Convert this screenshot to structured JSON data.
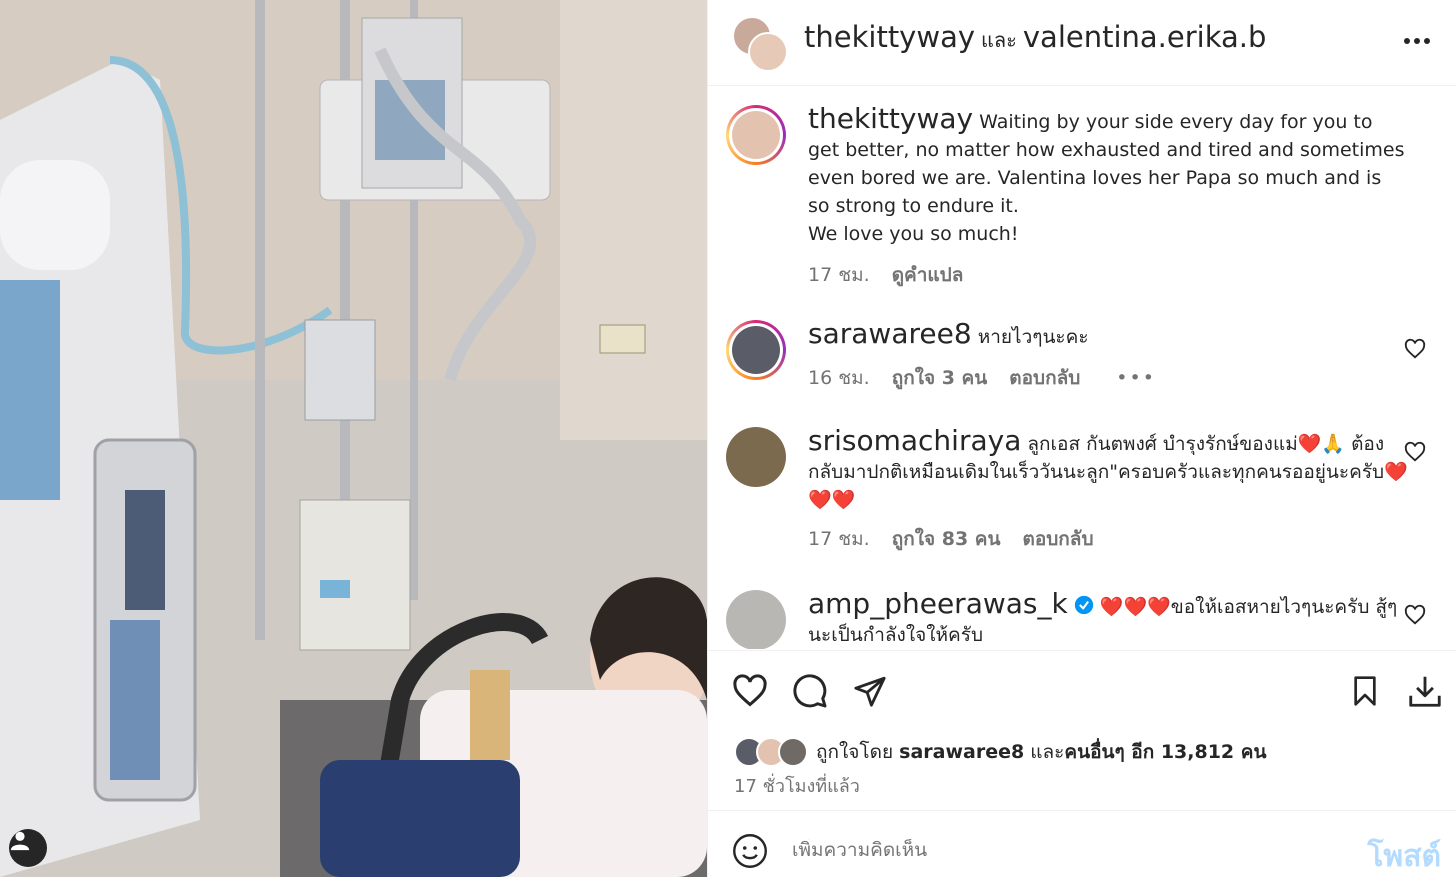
{
  "post": {
    "author": "thekittyway",
    "and_word": "และ",
    "coauthor": "valentina.erika.b",
    "more_icon": "more-horizontal-icon",
    "caption_user": "thekittyway",
    "caption_line1": "Waiting by your side every day for you to get better, no matter how exhausted and tired and sometimes even bored we are. Valentina loves her Papa so much and is so strong to endure it.",
    "caption_line2": "We love you so much!",
    "caption_time": "17 ชม.",
    "caption_translate": "ดูคำแปล"
  },
  "comments": [
    {
      "user": "sarawaree8",
      "text": "หายไวๆนะคะ",
      "time": "16 ชม.",
      "likes": "ถูกใจ 3 คน",
      "reply": "ตอบกลับ",
      "more": "•••"
    },
    {
      "user": "srisomachiraya",
      "text": "ลูกเอส กันตพงศ์ บำรุงรักษ์ของแม่❤️🙏 ต้องกลับมาปกติเหมือนเดิมในเร็ววันนะลูก\"ครอบครัวและทุกคนรออยู่นะครับ❤️❤️❤️",
      "time": "17 ชม.",
      "likes": "ถูกใจ 83 คน",
      "reply": "ตอบกลับ"
    },
    {
      "user": "amp_pheerawas_k",
      "text": "❤️❤️❤️ขอให้เอสหายไวๆนะครับ สู้ๆนะเป็นกำลังใจให้ครับ"
    }
  ],
  "actions": {
    "like_icon": "heart-icon",
    "comment_icon": "comment-icon",
    "share_icon": "send-icon",
    "save_icon": "bookmark-icon",
    "download_icon": "download-icon"
  },
  "likes": {
    "prefix": "ถูกใจโดย",
    "user": "sarawaree8",
    "and": "และ",
    "others": "คนอื่นๆ อีก 13,812 คน"
  },
  "timestamp": "17 ชั่วโมงที่แล้ว",
  "add_comment": {
    "placeholder": "เพิ่มความคิดเห็น",
    "post_label": "โพสต์"
  },
  "colors": {
    "post_button": "#b3dbff",
    "verified": "#0095f6",
    "heart": "#ed1c24"
  }
}
